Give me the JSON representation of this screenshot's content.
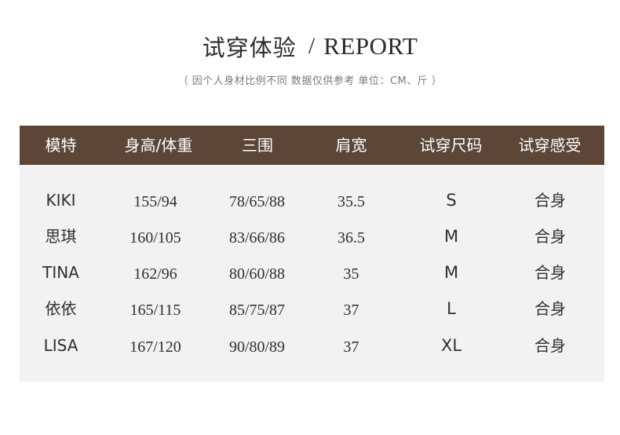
{
  "title": {
    "main": "试穿体验",
    "slash": "/",
    "sub": "REPORT"
  },
  "note": "（ 因个人身材比例不同  数据仅供参考  单位：CM、斤 ）",
  "table": {
    "headers": [
      "模特",
      "身高/体重",
      "三围",
      "肩宽",
      "试穿尺码",
      "试穿感受"
    ],
    "rows": [
      [
        "KIKI",
        "155/94",
        "78/65/88",
        "35.5",
        "S",
        "合身"
      ],
      [
        "思琪",
        "160/105",
        "83/66/86",
        "36.5",
        "M",
        "合身"
      ],
      [
        "TINA",
        "162/96",
        "80/60/88",
        "35",
        "M",
        "合身"
      ],
      [
        "依依",
        "165/115",
        "85/75/87",
        "37",
        "L",
        "合身"
      ],
      [
        "LISA",
        "167/120",
        "90/80/89",
        "37",
        "XL",
        "合身"
      ]
    ]
  },
  "colors": {
    "header_bg": "#5b4638",
    "header_text": "#ffffff",
    "table_bg": "#f2f2f2",
    "body_text": "#2f2f2f",
    "note_text": "#7a7a7a"
  }
}
